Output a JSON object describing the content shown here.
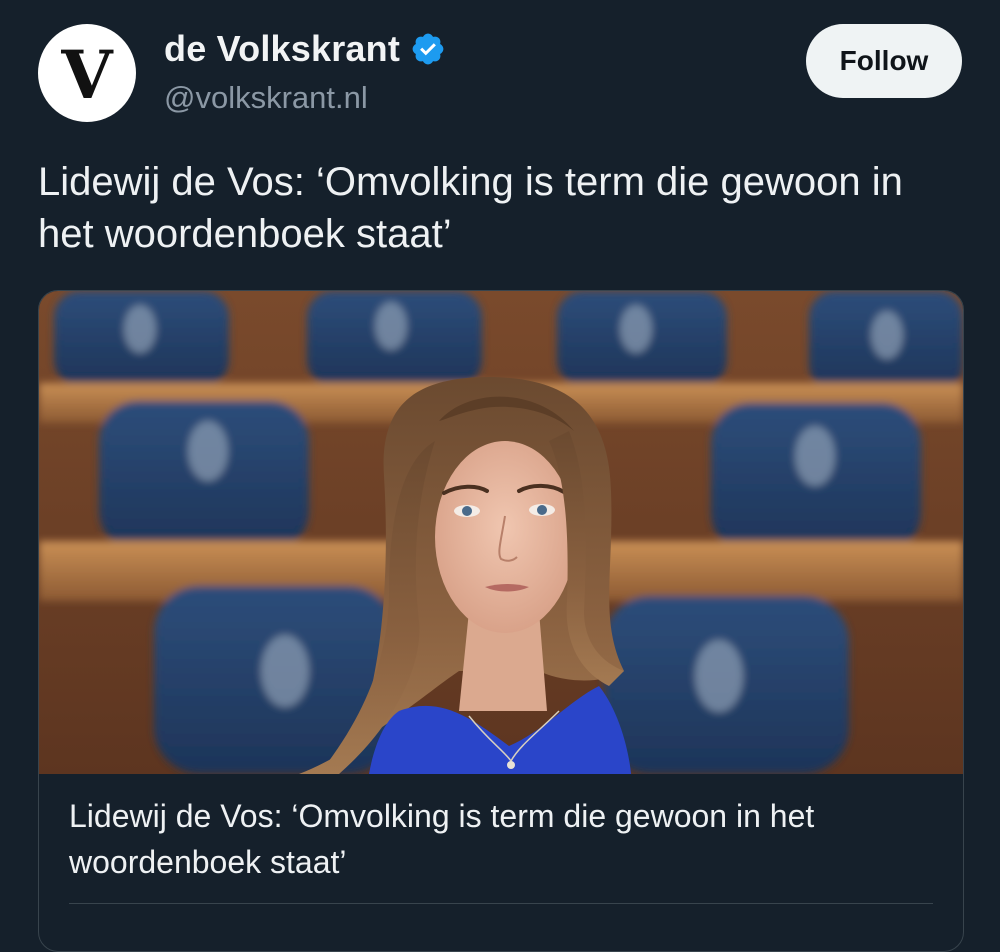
{
  "account": {
    "display_name": "de Volkskrant",
    "handle": "@volkskrant.nl",
    "avatar_letter": "V",
    "verified": true,
    "verified_icon": "verified-badge-icon",
    "verified_color": "#1d9bf0"
  },
  "actions": {
    "follow_label": "Follow"
  },
  "tweet": {
    "text": "Lidewij de Vos: ‘Omvolking is term die gewoon in het woordenboek staat’"
  },
  "card": {
    "image": "portrait-photo",
    "title": "Lidewij de Vos: ‘Omvolking is term die gewoon in het woordenboek staat’"
  },
  "colors": {
    "background": "#15202b",
    "text": "#e7e9ea",
    "secondary_text": "#8b98a5",
    "follow_button_bg": "#eff3f4",
    "border": "#38444d"
  }
}
